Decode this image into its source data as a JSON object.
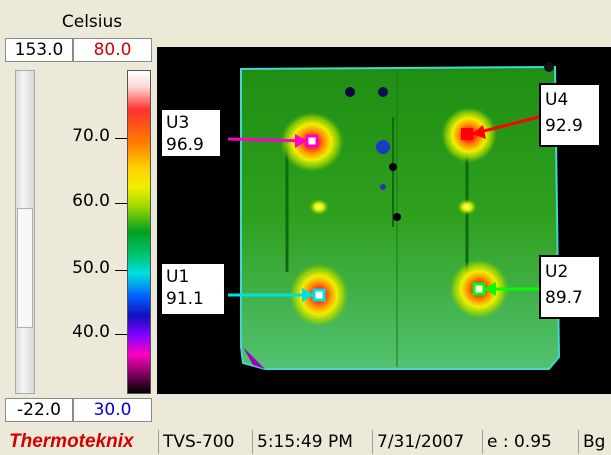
{
  "scale": {
    "unit": "Celsius",
    "max_value": "153.0",
    "max_setpoint": "80.0",
    "min_value": "-22.0",
    "min_setpoint": "30.0",
    "ticks": [
      "70.0",
      "60.0",
      "50.0",
      "40.0"
    ]
  },
  "callouts": [
    {
      "id": "U3",
      "value": "96.9",
      "color": "#ff00cc"
    },
    {
      "id": "U4",
      "value": "92.9",
      "color": "#ff0000"
    },
    {
      "id": "U1",
      "value": "91.1",
      "color": "#00e0e0"
    },
    {
      "id": "U2",
      "value": "89.7",
      "color": "#00ff00"
    }
  ],
  "status": {
    "brand": "Thermoteknix",
    "model": "TVS-700",
    "time": "5:15:49 PM",
    "date": "7/31/2007",
    "emissivity": "e : 0.95",
    "bg": "Bg"
  },
  "colors": {
    "max_setpoint": "#d00000",
    "min_setpoint": "#0000cc",
    "brand": "#d40000",
    "board": "#2f9a1e"
  }
}
